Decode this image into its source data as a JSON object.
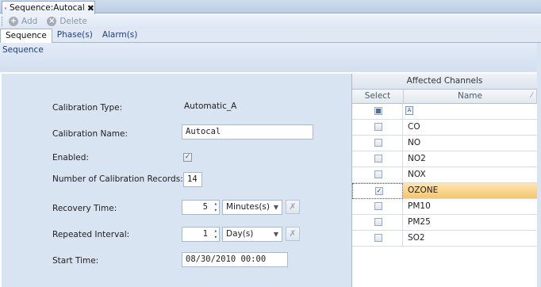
{
  "document_tab": {
    "title": "Sequence:Autocal",
    "close_glyph": "✖"
  },
  "toolbar": {
    "add_label": "Add",
    "delete_label": "Delete"
  },
  "subtabs": [
    "Sequence",
    "Phase(s)",
    "Alarm(s)"
  ],
  "section": {
    "title": "Sequence"
  },
  "form": {
    "calibration_type_label": "Calibration Type:",
    "calibration_type_value": "Automatic_A",
    "calibration_name_label": "Calibration Name:",
    "calibration_name_value": "Autocal",
    "enabled_label": "Enabled:",
    "enabled_checked": true,
    "records_label": "Number of Calibration Records:",
    "records_value": "14",
    "recovery_label": "Recovery Time:",
    "recovery_value": "5",
    "recovery_unit": "Minutes(s)",
    "interval_label": "Repeated Interval:",
    "interval_value": "1",
    "interval_unit": "Day(s)",
    "start_label": "Start Time:",
    "start_value": "08/30/2010 00:00"
  },
  "grid": {
    "title": "Affected Channels",
    "col_select": "Select",
    "col_name": "Name",
    "rows": [
      {
        "name": "CO",
        "checked": false
      },
      {
        "name": "NO",
        "checked": false
      },
      {
        "name": "NO2",
        "checked": false
      },
      {
        "name": "NOX",
        "checked": false
      },
      {
        "name": "OZONE",
        "checked": true
      },
      {
        "name": "PM10",
        "checked": false
      },
      {
        "name": "PM25",
        "checked": false
      },
      {
        "name": "SO2",
        "checked": false
      }
    ]
  },
  "colors": {
    "accent": "#1d3f85",
    "highlight": "#f6c56d",
    "panel_bg": "#d9e4f2"
  }
}
